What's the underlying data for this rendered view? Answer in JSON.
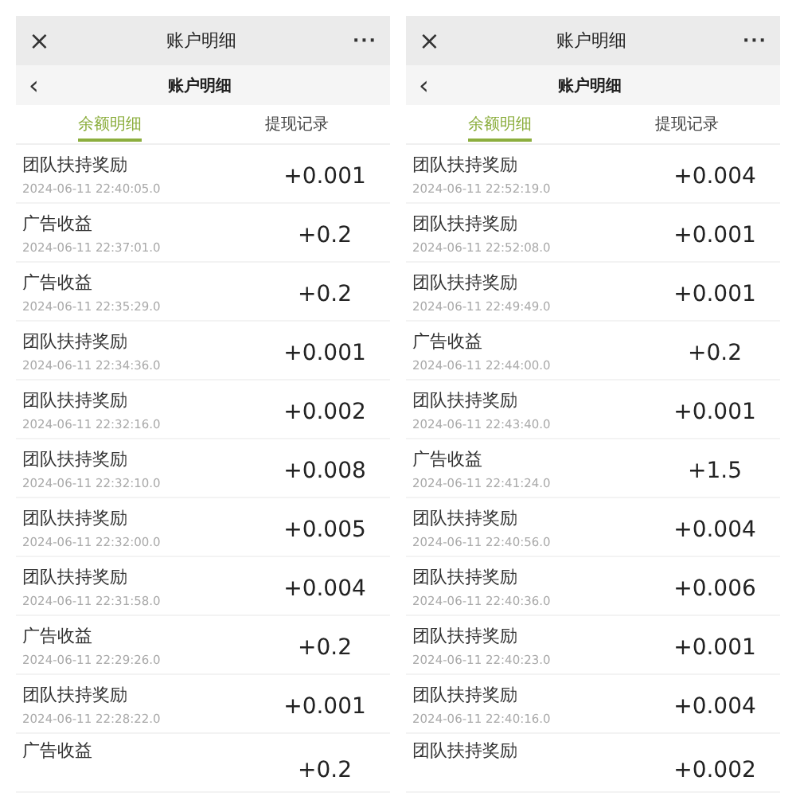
{
  "panels": [
    {
      "top_bar": {
        "close": "×",
        "title": "账户明细",
        "more": "···"
      },
      "nav_bar": {
        "back": "‹",
        "title": "账户明细"
      },
      "tabs": [
        {
          "label": "余额明细",
          "selected": true
        },
        {
          "label": "提现记录",
          "selected": false
        }
      ],
      "records": [
        {
          "title": "团队扶持奖励",
          "time": "2024-06-11 22:40:05.0",
          "amount": "+0.001"
        },
        {
          "title": "广告收益",
          "time": "2024-06-11 22:37:01.0",
          "amount": "+0.2"
        },
        {
          "title": "广告收益",
          "time": "2024-06-11 22:35:29.0",
          "amount": "+0.2"
        },
        {
          "title": "团队扶持奖励",
          "time": "2024-06-11 22:34:36.0",
          "amount": "+0.001"
        },
        {
          "title": "团队扶持奖励",
          "time": "2024-06-11 22:32:16.0",
          "amount": "+0.002"
        },
        {
          "title": "团队扶持奖励",
          "time": "2024-06-11 22:32:10.0",
          "amount": "+0.008"
        },
        {
          "title": "团队扶持奖励",
          "time": "2024-06-11 22:32:00.0",
          "amount": "+0.005"
        },
        {
          "title": "团队扶持奖励",
          "time": "2024-06-11 22:31:58.0",
          "amount": "+0.004"
        },
        {
          "title": "广告收益",
          "time": "2024-06-11 22:29:26.0",
          "amount": "+0.2"
        },
        {
          "title": "团队扶持奖励",
          "time": "2024-06-11 22:28:22.0",
          "amount": "+0.001"
        },
        {
          "title": "广告收益",
          "amount": "+0.2"
        }
      ]
    },
    {
      "top_bar": {
        "close": "×",
        "title": "账户明细",
        "more": "···"
      },
      "nav_bar": {
        "back": "‹",
        "title": "账户明细"
      },
      "tabs": [
        {
          "label": "余额明细",
          "selected": true
        },
        {
          "label": "提现记录",
          "selected": false
        }
      ],
      "records": [
        {
          "title": "团队扶持奖励",
          "time": "2024-06-11 22:52:19.0",
          "amount": "+0.004"
        },
        {
          "title": "团队扶持奖励",
          "time": "2024-06-11 22:52:08.0",
          "amount": "+0.001"
        },
        {
          "title": "团队扶持奖励",
          "time": "2024-06-11 22:49:49.0",
          "amount": "+0.001"
        },
        {
          "title": "广告收益",
          "time": "2024-06-11 22:44:00.0",
          "amount": "+0.2"
        },
        {
          "title": "团队扶持奖励",
          "time": "2024-06-11 22:43:40.0",
          "amount": "+0.001"
        },
        {
          "title": "广告收益",
          "time": "2024-06-11 22:41:24.0",
          "amount": "+1.5"
        },
        {
          "title": "团队扶持奖励",
          "time": "2024-06-11 22:40:56.0",
          "amount": "+0.004"
        },
        {
          "title": "团队扶持奖励",
          "time": "2024-06-11 22:40:36.0",
          "amount": "+0.006"
        },
        {
          "title": "团队扶持奖励",
          "time": "2024-06-11 22:40:23.0",
          "amount": "+0.001"
        },
        {
          "title": "团队扶持奖励",
          "time": "2024-06-11 22:40:16.0",
          "amount": "+0.004"
        },
        {
          "title": "团队扶持奖励",
          "amount": "+0.002"
        }
      ]
    }
  ]
}
